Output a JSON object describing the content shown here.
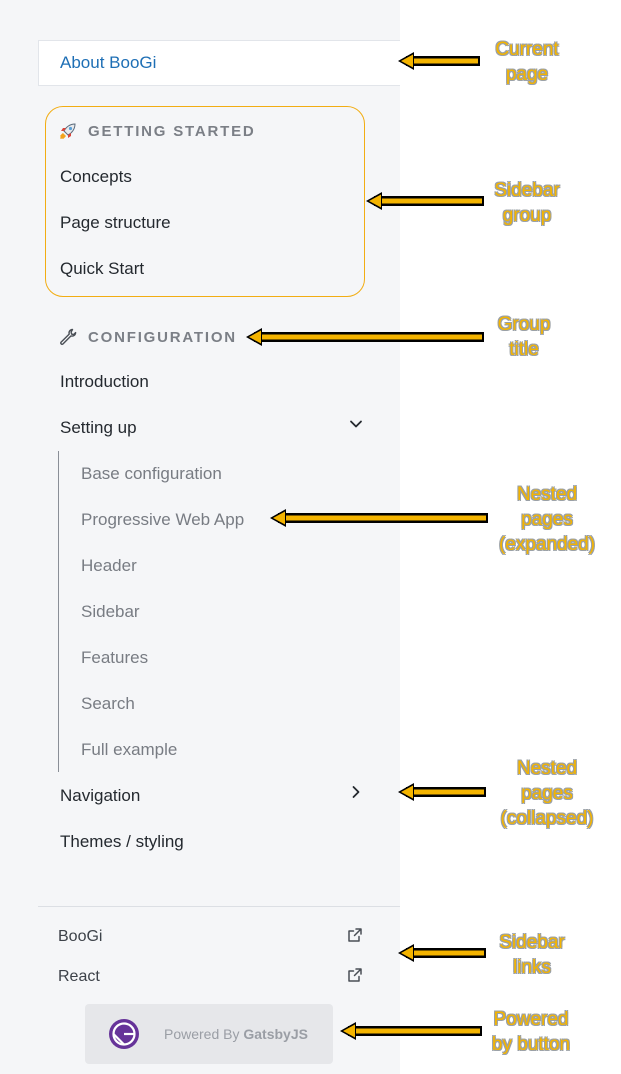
{
  "sidebar": {
    "current_page": "About BooGi",
    "groups": [
      {
        "title": "GETTING STARTED",
        "icon": "rocket-icon",
        "items": [
          "Concepts",
          "Page structure",
          "Quick Start"
        ]
      },
      {
        "title": "CONFIGURATION",
        "icon": "wrench-icon",
        "items": [
          {
            "label": "Introduction"
          },
          {
            "label": "Setting up",
            "expanded": true,
            "children": [
              "Base configuration",
              "Progressive Web App",
              "Header",
              "Sidebar",
              "Features",
              "Search",
              "Full example"
            ]
          },
          {
            "label": "Navigation",
            "expanded": false
          },
          {
            "label": "Themes / styling"
          }
        ]
      }
    ],
    "links": [
      {
        "label": "BooGi",
        "icon": "external-link-icon"
      },
      {
        "label": "React",
        "icon": "external-link-icon"
      }
    ],
    "powered_by": {
      "prefix": "Powered By",
      "name": "GatsbyJS",
      "icon": "gatsby-logo-icon"
    }
  },
  "annotations": {
    "current_page": [
      "Current",
      "page"
    ],
    "sidebar_group": [
      "Sidebar",
      "group"
    ],
    "group_title": [
      "Group",
      "title"
    ],
    "nested_expanded": [
      "Nested",
      "pages",
      "(expanded)"
    ],
    "nested_collapsed": [
      "Nested",
      "pages",
      "(collapsed)"
    ],
    "sidebar_links": [
      "Sidebar",
      "links"
    ],
    "powered_by": [
      "Powered",
      "by button"
    ]
  },
  "colors": {
    "accent": "#1e6fb5",
    "highlight": "#f2ad13",
    "annotation": "#f4b400",
    "sidebar_bg": "#f5f6f8"
  }
}
